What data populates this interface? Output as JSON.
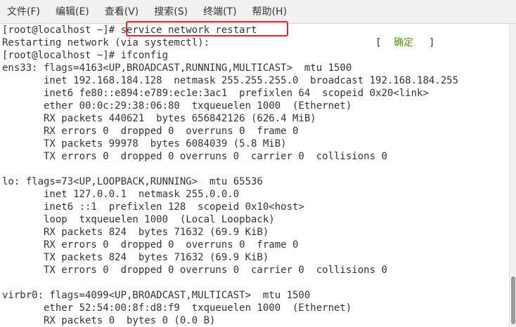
{
  "menu": [
    "文件(F)",
    "编辑(E)",
    "查看(V)",
    "搜索(S)",
    "终端(T)",
    "帮助(H)"
  ],
  "terminal": {
    "lines": [
      "[root@localhost ~]# service network restart",
      "Restarting network (via systemctl):",
      "[root@localhost ~]# ifconfig",
      "ens33: flags=4163<UP,BROADCAST,RUNNING,MULTICAST>  mtu 1500",
      "       inet 192.168.184.128  netmask 255.255.255.0  broadcast 192.168.184.255",
      "       inet6 fe80::e894:e789:ec1e:3ac1  prefixlen 64  scopeid 0x20<link>",
      "       ether 00:0c:29:38:06:80  txqueuelen 1000  (Ethernet)",
      "       RX packets 440621  bytes 656842126 (626.4 MiB)",
      "       RX errors 0  dropped 0  overruns 0  frame 0",
      "       TX packets 99978  bytes 6084039 (5.8 MiB)",
      "       TX errors 0  dropped 0 overruns 0  carrier 0  collisions 0",
      "",
      "lo: flags=73<UP,LOOPBACK,RUNNING>  mtu 65536",
      "       inet 127.0.0.1  netmask 255.0.0.0",
      "       inet6 ::1  prefixlen 128  scopeid 0x10<host>",
      "       loop  txqueuelen 1000  (Local Loopback)",
      "       RX packets 824  bytes 71632 (69.9 KiB)",
      "       RX errors 0  dropped 0  overruns 0  frame 0",
      "       TX packets 824  bytes 71632 (69.9 KiB)",
      "       TX errors 0  dropped 0 overruns 0  carrier 0  collisions 0",
      "",
      "virbr0: flags=4099<UP,BROADCAST,MULTICAST>  mtu 1500",
      "       ether 52:54:00:8f:d8:f9  txqueuelen 1000  (Ethernet)",
      "       RX packets 0  bytes 0 (0.0 B)"
    ],
    "status_open": "[",
    "status_ok": "确定",
    "status_close": "]"
  },
  "colors": {
    "ok_text": "#4e9a06",
    "highlight": "#e0262a"
  }
}
